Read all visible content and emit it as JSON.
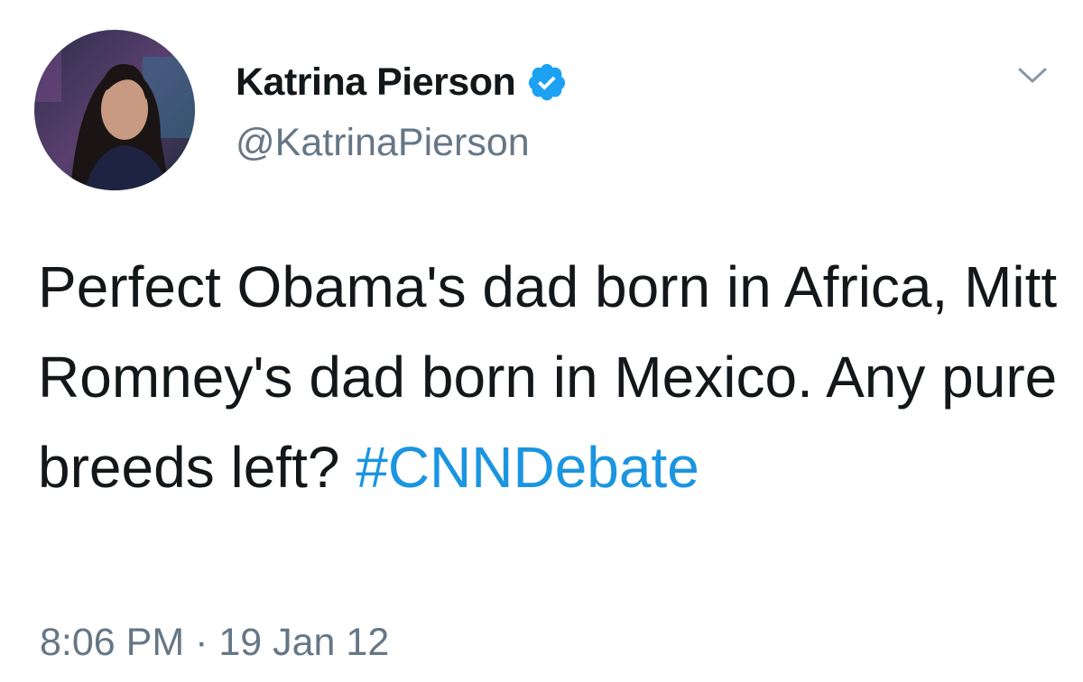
{
  "author": {
    "display_name": "Katrina Pierson",
    "handle": "@KatrinaPierson",
    "verified": true
  },
  "tweet": {
    "text": "Perfect Obama's dad born in Africa, Mitt Romney's dad born in Mexico. Any pure breeds left?",
    "hashtag": "#CNNDebate",
    "timestamp": "8:06 PM · 19 Jan 12"
  },
  "icons": {
    "verified": "verified-badge-icon",
    "menu": "chevron-down-icon"
  },
  "colors": {
    "text": "#14171a",
    "secondary": "#657786",
    "link": "#1b95e0",
    "verified": "#1da1f2"
  }
}
